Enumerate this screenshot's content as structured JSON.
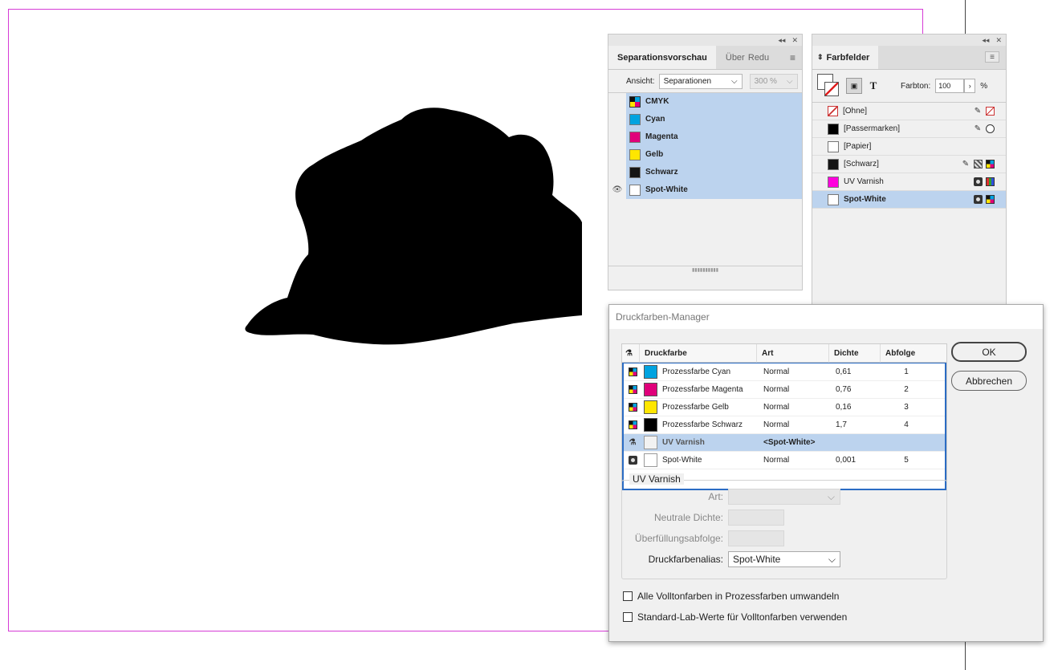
{
  "separations_panel": {
    "tabs": [
      "Separationsvorschau",
      "Über",
      "Redu"
    ],
    "view_label": "Ansicht:",
    "view_value": "Separationen",
    "zoom_value": "300 %",
    "rows": [
      {
        "name": "CMYK",
        "swatch": "cmyk",
        "visible": false
      },
      {
        "name": "Cyan",
        "swatch": "#00a3e0",
        "visible": false
      },
      {
        "name": "Magenta",
        "swatch": "#e0007a",
        "visible": false
      },
      {
        "name": "Gelb",
        "swatch": "#ffe600",
        "visible": false
      },
      {
        "name": "Schwarz",
        "swatch": "#151515",
        "visible": false
      },
      {
        "name": "Spot-White",
        "swatch": "#ffffff",
        "visible": true
      }
    ]
  },
  "swatches_panel": {
    "tab": "Farbfelder",
    "tint_label": "Farbton:",
    "tint_value": "100",
    "tint_unit": "%",
    "rows": [
      {
        "name": "[Ohne]",
        "swatch": "none",
        "selected": false
      },
      {
        "name": "[Passermarken]",
        "swatch": "#000000",
        "selected": false
      },
      {
        "name": "[Papier]",
        "swatch": "#ffffff",
        "selected": false
      },
      {
        "name": "[Schwarz]",
        "swatch": "#151515",
        "selected": false
      },
      {
        "name": "UV Varnish",
        "swatch": "#ff00dd",
        "selected": false
      },
      {
        "name": "Spot-White",
        "swatch": "#ffffff",
        "selected": true
      }
    ]
  },
  "ink_manager": {
    "title": "Druckfarben-Manager",
    "columns": [
      "Druckfarbe",
      "Art",
      "Dichte",
      "Abfolge"
    ],
    "inks": [
      {
        "name": "Prozessfarbe Cyan",
        "color": "#00a3e0",
        "type": "Normal",
        "density": "0,61",
        "sequence": "1",
        "kind": "process",
        "selected": false
      },
      {
        "name": "Prozessfarbe Magenta",
        "color": "#e0007a",
        "type": "Normal",
        "density": "0,76",
        "sequence": "2",
        "kind": "process",
        "selected": false
      },
      {
        "name": "Prozessfarbe Gelb",
        "color": "#ffe600",
        "type": "Normal",
        "density": "0,16",
        "sequence": "3",
        "kind": "process",
        "selected": false
      },
      {
        "name": "Prozessfarbe Schwarz",
        "color": "#000000",
        "type": "Normal",
        "density": "1,7",
        "sequence": "4",
        "kind": "process",
        "selected": false
      },
      {
        "name": "UV Varnish",
        "color": "#f2f2f2",
        "type": "<Spot-White>",
        "density": "",
        "sequence": "",
        "kind": "alias",
        "selected": true
      },
      {
        "name": "Spot-White",
        "color": "#ffffff",
        "type": "Normal",
        "density": "0,001",
        "sequence": "5",
        "kind": "spot",
        "selected": false
      }
    ],
    "ok_label": "OK",
    "cancel_label": "Abbrechen",
    "group_title": "UV Varnish",
    "art_label": "Art:",
    "neutral_density_label": "Neutrale Dichte:",
    "trap_sequence_label": "Überfüllungsabfolge:",
    "alias_label": "Druckfarbenalias:",
    "alias_value": "Spot-White",
    "checkbox_1": "Alle Volltonfarben in Prozessfarben umwandeln",
    "checkbox_2": "Standard-Lab-Werte für Volltonfarben verwenden"
  }
}
